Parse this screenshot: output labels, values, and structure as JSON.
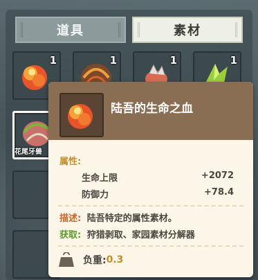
{
  "tabs": {
    "items": "道具",
    "materials": "素材"
  },
  "slots": [
    {
      "count": "1"
    },
    {
      "count": "1"
    },
    {
      "count": "1"
    },
    {
      "count": "1"
    }
  ],
  "selected_slot": {
    "name": "花尾牙兽"
  },
  "tooltip": {
    "title": "陆吾的生命之血",
    "attr_label": "属性:",
    "attrs": [
      {
        "name": "生命上限",
        "value": "+2072"
      },
      {
        "name": "防御力",
        "value": "+78.4"
      }
    ],
    "desc_label": "描述:",
    "desc_text": "陆吾特定的属性素材。",
    "obtain_label": "获取:",
    "obtain_text": "狩猎剥取、家园素材分解器",
    "weight_label": "负重:",
    "weight_value": "0.3"
  }
}
